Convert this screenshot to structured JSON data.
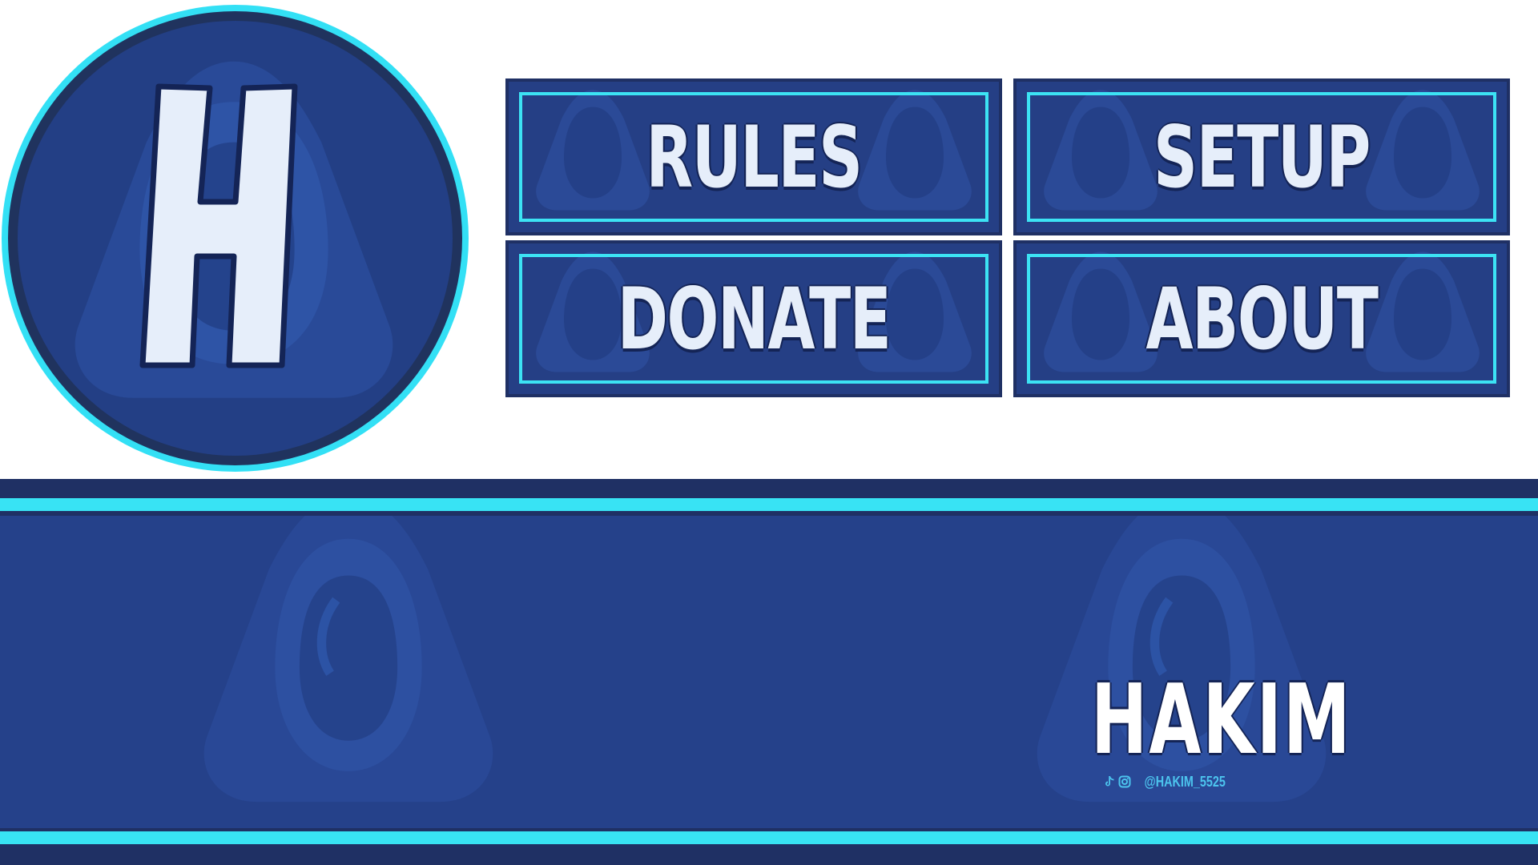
{
  "logo": {
    "letter": "H",
    "icon": "hood-silhouette-icon"
  },
  "panels": [
    {
      "label": "RULES"
    },
    {
      "label": "SETUP"
    },
    {
      "label": "DONATE"
    },
    {
      "label": "ABOUT"
    }
  ],
  "banner": {
    "name": "HAKIM",
    "handle": "@HAKIM_5525",
    "social_icons": [
      "tiktok-icon",
      "instagram-icon"
    ]
  },
  "colors": {
    "accent_cyan": "#38e3f4",
    "navy_dark": "#1f3064",
    "navy": "#25418a",
    "letter": "#e6eefa"
  }
}
